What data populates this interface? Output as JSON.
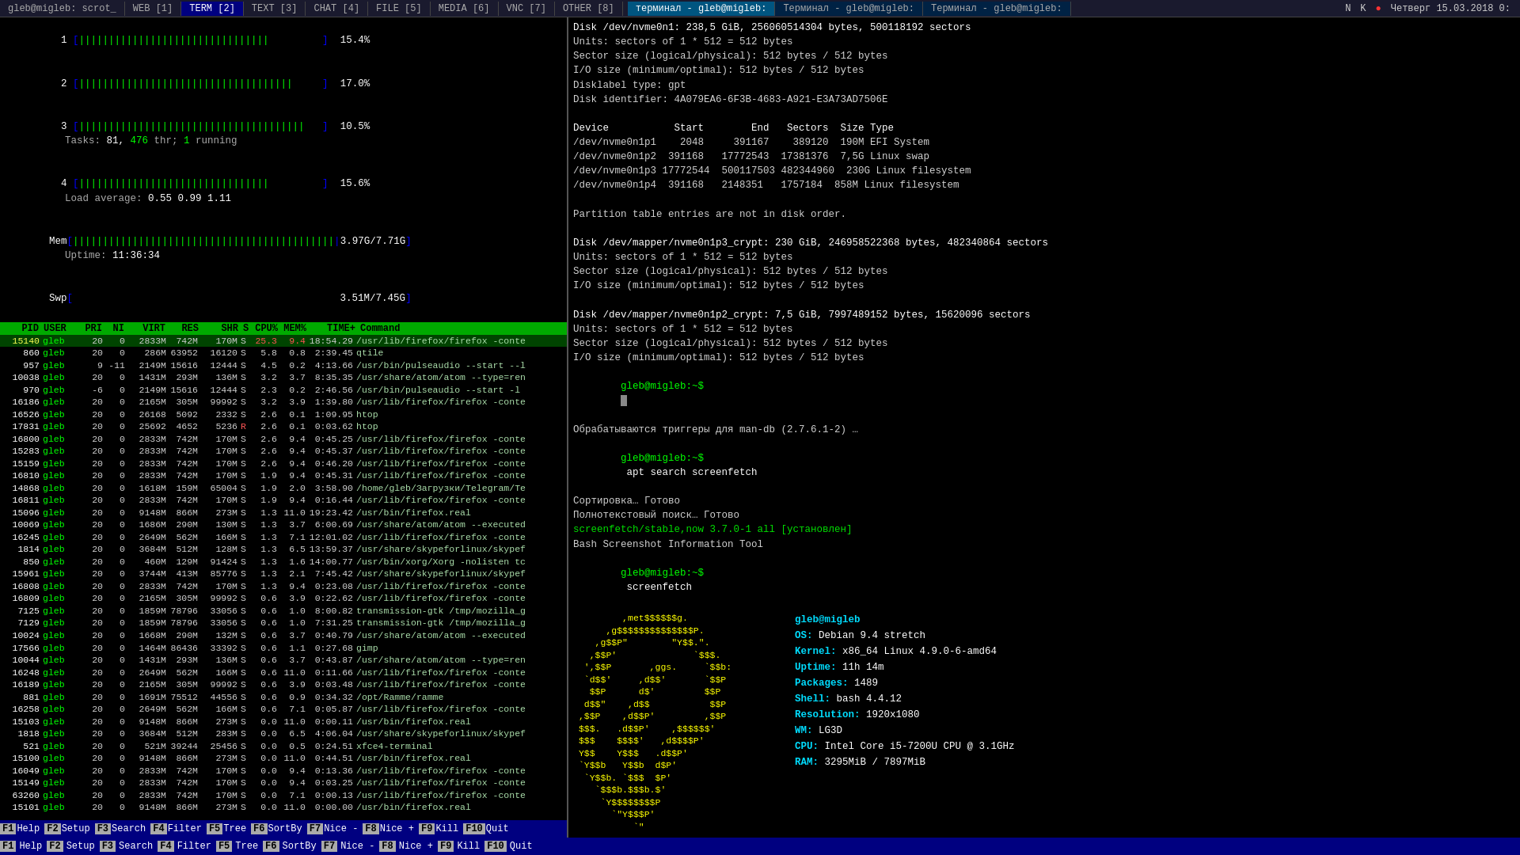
{
  "topbar": {
    "tabs": [
      {
        "label": "gleb@migleb: scrot_",
        "active": false,
        "type": "main"
      },
      {
        "label": "WEB [1]",
        "active": false
      },
      {
        "label": "TERM [2]",
        "active": true
      },
      {
        "label": "TEXT [3]",
        "active": false
      },
      {
        "label": "CHAT [4]",
        "active": false
      },
      {
        "label": "FILE [5]",
        "active": false
      },
      {
        "label": "MEDIA [6]",
        "active": false
      },
      {
        "label": "VNC [7]",
        "active": false
      },
      {
        "label": "OTHER [8]",
        "active": false
      }
    ],
    "right_tabs": [
      {
        "label": "терминал - gleb@migleb:",
        "active": true
      },
      {
        "label": "Терминал - gleb@migleb:",
        "active": false
      },
      {
        "label": "Терминал - gleb@migleb:",
        "active": false
      }
    ],
    "clock": "Четверг 15.03.2018 0:",
    "icons": [
      "N",
      "K",
      "🔴"
    ]
  },
  "htop": {
    "cpu_bars": [
      {
        "id": "1",
        "bar": "||||||||||||||||||||||||||||||||",
        "pct": "15.4"
      },
      {
        "id": "2",
        "bar": "||||||||||||||||||||||||||||||||||||",
        "pct": "17.0"
      },
      {
        "id": "3",
        "bar": "||||||||||||||||||||||||||||||||||||||",
        "pct": "10.5"
      },
      {
        "id": "4",
        "bar": "||||||||||||||||||||||||||||||||",
        "pct": "15.6"
      }
    ],
    "mem": {
      "bar": "||||||||||||||||||||||||||||||||||||||||||||",
      "used": "3.97G",
      "total": "7.71G"
    },
    "swp": {
      "bar": "",
      "used": "3.51M",
      "total": "7.45G"
    },
    "tasks": "81",
    "thr": "476",
    "running": "1",
    "load_avg": "0.55 0.99 1.11",
    "uptime": "11:36:34",
    "columns": [
      "PID",
      "USER",
      "PRI",
      "NI",
      "VIRT",
      "RES",
      "SHR",
      "S",
      "CPU%",
      "MEM%",
      "TIME+",
      "Command"
    ],
    "processes": [
      {
        "pid": "15140",
        "user": "gleb",
        "pri": "20",
        "ni": "0",
        "virt": "2833M",
        "res": "742M",
        "shr": "170M",
        "s": "S",
        "cpu": "25.3",
        "mem": "9.4",
        "time": "18:54.29",
        "cmd": "/usr/lib/firefox/firefox -conte",
        "selected": true
      },
      {
        "pid": "860",
        "user": "gleb",
        "pri": "20",
        "ni": "0",
        "virt": "286M",
        "res": "63952",
        "shr": "16120",
        "s": "S",
        "cpu": "5.8",
        "mem": "0.8",
        "time": "2:39.45",
        "cmd": "qtile"
      },
      {
        "pid": "957",
        "user": "gleb",
        "pri": "9",
        "ni": "-11",
        "virt": "2149M",
        "res": "15616",
        "shr": "12444",
        "s": "S",
        "cpu": "4.2",
        "mem": "0.2",
        "time": "4:13.66",
        "cmd": "/usr/bin/pulseaudio --start --l"
      },
      {
        "pid": "10038",
        "user": "gleb",
        "pri": "20",
        "ni": "0",
        "virt": "1431M",
        "res": "293M",
        "shr": "136M",
        "s": "S",
        "cpu": "3.2",
        "mem": "3.7",
        "time": "8:35.35",
        "cmd": "/usr/share/atom/atom --type=ren"
      },
      {
        "pid": "970",
        "user": "gleb",
        "pri": "-6",
        "ni": "0",
        "virt": "2149M",
        "res": "15616",
        "shr": "12444",
        "s": "S",
        "cpu": "2.3",
        "mem": "0.2",
        "time": "2:46.56",
        "cmd": "/usr/bin/pulseaudio --start -l"
      },
      {
        "pid": "16186",
        "user": "gleb",
        "pri": "20",
        "ni": "0",
        "virt": "2165M",
        "res": "305M",
        "shr": "99992",
        "s": "S",
        "cpu": "3.2",
        "mem": "3.9",
        "time": "1:39.80",
        "cmd": "/usr/lib/firefox/firefox -conte"
      },
      {
        "pid": "16526",
        "user": "gleb",
        "pri": "20",
        "ni": "0",
        "virt": "26168",
        "res": "5092",
        "shr": "2332",
        "s": "S",
        "cpu": "2.6",
        "mem": "0.1",
        "time": "1:09.95",
        "cmd": "htop"
      },
      {
        "pid": "17831",
        "user": "gleb",
        "pri": "20",
        "ni": "0",
        "virt": "25692",
        "res": "4652",
        "shr": "5236",
        "s": "R",
        "cpu": "2.6",
        "mem": "0.1",
        "time": "0:03.62",
        "cmd": "htop"
      },
      {
        "pid": "16800",
        "user": "gleb",
        "pri": "20",
        "ni": "0",
        "virt": "2833M",
        "res": "742M",
        "shr": "170M",
        "s": "S",
        "cpu": "2.6",
        "mem": "9.4",
        "time": "0:45.25",
        "cmd": "/usr/lib/firefox/firefox -conte"
      },
      {
        "pid": "15283",
        "user": "gleb",
        "pri": "20",
        "ni": "0",
        "virt": "2833M",
        "res": "742M",
        "shr": "170M",
        "s": "S",
        "cpu": "2.6",
        "mem": "9.4",
        "time": "0:45.37",
        "cmd": "/usr/lib/firefox/firefox -conte"
      },
      {
        "pid": "15159",
        "user": "gleb",
        "pri": "20",
        "ni": "0",
        "virt": "2833M",
        "res": "742M",
        "shr": "170M",
        "s": "S",
        "cpu": "2.6",
        "mem": "9.4",
        "time": "0:46.20",
        "cmd": "/usr/lib/firefox/firefox -conte"
      },
      {
        "pid": "16810",
        "user": "gleb",
        "pri": "20",
        "ni": "0",
        "virt": "2833M",
        "res": "742M",
        "shr": "170M",
        "s": "S",
        "cpu": "1.9",
        "mem": "9.4",
        "time": "0:45.31",
        "cmd": "/usr/lib/firefox/firefox -conte"
      },
      {
        "pid": "14868",
        "user": "gleb",
        "pri": "20",
        "ni": "0",
        "virt": "1618M",
        "res": "159M",
        "shr": "65004",
        "s": "S",
        "cpu": "1.9",
        "mem": "2.0",
        "time": "3:58.90",
        "cmd": "/home/gleb/Загрузки/Telegram/Te"
      },
      {
        "pid": "16811",
        "user": "gleb",
        "pri": "20",
        "ni": "0",
        "virt": "2833M",
        "res": "742M",
        "shr": "170M",
        "s": "S",
        "cpu": "1.9",
        "mem": "9.4",
        "time": "0:16.44",
        "cmd": "/usr/lib/firefox/firefox -conte"
      },
      {
        "pid": "15096",
        "user": "gleb",
        "pri": "20",
        "ni": "0",
        "virt": "9148M",
        "res": "866M",
        "shr": "273M",
        "s": "S",
        "cpu": "1.3",
        "mem": "11.0",
        "time": "19:23.42",
        "cmd": "/usr/bin/firefox.real"
      },
      {
        "pid": "10069",
        "user": "gleb",
        "pri": "20",
        "ni": "0",
        "virt": "1686M",
        "res": "290M",
        "shr": "130M",
        "s": "S",
        "cpu": "1.3",
        "mem": "3.7",
        "time": "6:00.69",
        "cmd": "/usr/share/atom/atom --executed"
      },
      {
        "pid": "16245",
        "user": "gleb",
        "pri": "20",
        "ni": "0",
        "virt": "2649M",
        "res": "562M",
        "shr": "166M",
        "s": "S",
        "cpu": "1.3",
        "mem": "7.1",
        "time": "12:01.02",
        "cmd": "/usr/lib/firefox/firefox -conte"
      },
      {
        "pid": "1814",
        "user": "gleb",
        "pri": "20",
        "ni": "0",
        "virt": "3684M",
        "res": "512M",
        "shr": "128M",
        "s": "S",
        "cpu": "1.3",
        "mem": "6.5",
        "time": "13:59.37",
        "cmd": "/usr/share/skypeforlinux/skypef"
      },
      {
        "pid": "850",
        "user": "gleb",
        "pri": "20",
        "ni": "0",
        "virt": "460M",
        "res": "129M",
        "shr": "91424",
        "s": "S",
        "cpu": "1.3",
        "mem": "1.6",
        "time": "14:00.77",
        "cmd": "/usr/bin/xorg/Xorg -nolisten tc"
      },
      {
        "pid": "15961",
        "user": "gleb",
        "pri": "20",
        "ni": "0",
        "virt": "3744M",
        "res": "413M",
        "shr": "85776",
        "s": "S",
        "cpu": "1.3",
        "mem": "2.1",
        "time": "7:45.42",
        "cmd": "/usr/share/skypeforlinux/skypef"
      },
      {
        "pid": "16808",
        "user": "gleb",
        "pri": "20",
        "ni": "0",
        "virt": "2833M",
        "res": "742M",
        "shr": "170M",
        "s": "S",
        "cpu": "1.3",
        "mem": "9.4",
        "time": "0:23.08",
        "cmd": "/usr/lib/firefox/firefox -conte"
      },
      {
        "pid": "16809",
        "user": "gleb",
        "pri": "20",
        "ni": "0",
        "virt": "2165M",
        "res": "305M",
        "shr": "99992",
        "s": "S",
        "cpu": "0.6",
        "mem": "3.9",
        "time": "0:22.62",
        "cmd": "/usr/lib/firefox/firefox -conte"
      },
      {
        "pid": "7125",
        "user": "gleb",
        "pri": "20",
        "ni": "0",
        "virt": "1859M",
        "res": "78796",
        "shr": "33056",
        "s": "S",
        "cpu": "0.6",
        "mem": "1.0",
        "time": "8:00.82",
        "cmd": "transmission-gtk /tmp/mozilla_g"
      },
      {
        "pid": "7129",
        "user": "gleb",
        "pri": "20",
        "ni": "0",
        "virt": "1859M",
        "res": "78796",
        "shr": "33056",
        "s": "S",
        "cpu": "0.6",
        "mem": "1.0",
        "time": "7:31.25",
        "cmd": "transmission-gtk /tmp/mozilla_g"
      },
      {
        "pid": "10024",
        "user": "gleb",
        "pri": "20",
        "ni": "0",
        "virt": "1668M",
        "res": "290M",
        "shr": "132M",
        "s": "S",
        "cpu": "0.6",
        "mem": "3.7",
        "time": "0:40.79",
        "cmd": "/usr/share/atom/atom --executed"
      },
      {
        "pid": "17566",
        "user": "gleb",
        "pri": "20",
        "ni": "0",
        "virt": "1464M",
        "res": "86436",
        "shr": "33392",
        "s": "S",
        "cpu": "0.6",
        "mem": "1.1",
        "time": "0:27.68",
        "cmd": "gimp"
      },
      {
        "pid": "10044",
        "user": "gleb",
        "pri": "20",
        "ni": "0",
        "virt": "1431M",
        "res": "293M",
        "shr": "136M",
        "s": "S",
        "cpu": "0.6",
        "mem": "3.7",
        "time": "0:43.87",
        "cmd": "/usr/share/atom/atom --type=ren"
      },
      {
        "pid": "16248",
        "user": "gleb",
        "pri": "20",
        "ni": "0",
        "virt": "2649M",
        "res": "562M",
        "shr": "166M",
        "s": "S",
        "cpu": "0.6",
        "mem": "11.0",
        "time": "0:11.66",
        "cmd": "/usr/lib/firefox/firefox -conte"
      },
      {
        "pid": "16189",
        "user": "gleb",
        "pri": "20",
        "ni": "0",
        "virt": "2165M",
        "res": "305M",
        "shr": "99992",
        "s": "S",
        "cpu": "0.6",
        "mem": "3.9",
        "time": "0:03.48",
        "cmd": "/usr/lib/firefox/firefox -conte"
      },
      {
        "pid": "881",
        "user": "gleb",
        "pri": "20",
        "ni": "0",
        "virt": "1691M",
        "res": "75512",
        "shr": "44556",
        "s": "S",
        "cpu": "0.6",
        "mem": "0.9",
        "time": "0:34.32",
        "cmd": "/opt/Ramme/ramme"
      },
      {
        "pid": "16258",
        "user": "gleb",
        "pri": "20",
        "ni": "0",
        "virt": "2649M",
        "res": "562M",
        "shr": "166M",
        "s": "S",
        "cpu": "0.6",
        "mem": "7.1",
        "time": "0:05.87",
        "cmd": "/usr/lib/firefox/firefox -conte"
      },
      {
        "pid": "15103",
        "user": "gleb",
        "pri": "20",
        "ni": "0",
        "virt": "9148M",
        "res": "866M",
        "shr": "273M",
        "s": "S",
        "cpu": "0.0",
        "mem": "11.0",
        "time": "0:00.11",
        "cmd": "/usr/bin/firefox.real"
      },
      {
        "pid": "1818",
        "user": "gleb",
        "pri": "20",
        "ni": "0",
        "virt": "3684M",
        "res": "512M",
        "shr": "283M",
        "s": "S",
        "cpu": "0.0",
        "mem": "6.5",
        "time": "4:06.04",
        "cmd": "/usr/share/skypeforlinux/skypef"
      },
      {
        "pid": "521",
        "user": "gleb",
        "pri": "20",
        "ni": "0",
        "virt": "521M",
        "res": "39244",
        "shr": "25456",
        "s": "S",
        "cpu": "0.0",
        "mem": "0.5",
        "time": "0:24.51",
        "cmd": "xfce4-terminal"
      },
      {
        "pid": "15100",
        "user": "gleb",
        "pri": "20",
        "ni": "0",
        "virt": "9148M",
        "res": "866M",
        "shr": "273M",
        "s": "S",
        "cpu": "0.0",
        "mem": "11.0",
        "time": "0:44.51",
        "cmd": "/usr/bin/firefox.real"
      },
      {
        "pid": "16049",
        "user": "gleb",
        "pri": "20",
        "ni": "0",
        "virt": "2833M",
        "res": "742M",
        "shr": "170M",
        "s": "S",
        "cpu": "0.0",
        "mem": "9.4",
        "time": "0:13.36",
        "cmd": "/usr/lib/firefox/firefox -conte"
      },
      {
        "pid": "15149",
        "user": "gleb",
        "pri": "20",
        "ni": "0",
        "virt": "2833M",
        "res": "742M",
        "shr": "170M",
        "s": "S",
        "cpu": "0.0",
        "mem": "9.4",
        "time": "0:03.25",
        "cmd": "/usr/lib/firefox/firefox -conte"
      },
      {
        "pid": "63260",
        "user": "gleb",
        "pri": "20",
        "ni": "0",
        "virt": "2833M",
        "res": "742M",
        "shr": "170M",
        "s": "S",
        "cpu": "0.0",
        "mem": "7.1",
        "time": "0:00.13",
        "cmd": "/usr/lib/firefox/firefox -conte"
      },
      {
        "pid": "15101",
        "user": "gleb",
        "pri": "20",
        "ni": "0",
        "virt": "9148M",
        "res": "866M",
        "shr": "273M",
        "s": "S",
        "cpu": "0.0",
        "mem": "11.0",
        "time": "0:00.00",
        "cmd": "/usr/bin/firefox.real"
      }
    ],
    "bottom_keys": [
      {
        "key": "F1",
        "label": "Help"
      },
      {
        "key": "F2",
        "label": "Setup"
      },
      {
        "key": "F3",
        "label": "Search"
      },
      {
        "key": "F4",
        "label": "Filter"
      },
      {
        "key": "F5",
        "label": "Tree"
      },
      {
        "key": "F6",
        "label": "SortBy"
      },
      {
        "key": "F7",
        "label": "Nice -"
      },
      {
        "key": "F8",
        "label": "Nice +"
      },
      {
        "key": "F9",
        "label": "Kill"
      },
      {
        "key": "F10",
        "label": "Quit"
      }
    ]
  },
  "terminal": {
    "disk_output": [
      "Disk /dev/nvme0n1: 238,5 GiB, 256060514304 bytes, 500118192 sectors",
      "Units: sectors of 1 * 512 = 512 bytes",
      "Sector size (logical/physical): 512 bytes / 512 bytes",
      "I/O size (minimum/optimal): 512 bytes / 512 bytes",
      "Disklabel type: gpt",
      "Disk identifier: 4A079EA6-6F3B-4683-A921-E3A73AD7506E",
      "",
      "Device           Start        End   Sectors  Size Type",
      "/dev/nvme0n1p1    2048     391167    389120  190M EFI System",
      "/dev/nvme0n1p2  391168   17772543  17381376  7,5G Linux swap",
      "/dev/nvme0n1p3 17772544  500117503 482344960  230G Linux filesystem",
      "/dev/nvme0n1p4  391168   2148351   1757184  858M Linux filesystem",
      "",
      "Partition table entries are not in disk order.",
      "",
      "Disk /dev/mapper/nvme0n1p3_crypt: 230 GiB, 246958522368 bytes, 482340864 sectors",
      "Units: sectors of 1 * 512 = 512 bytes",
      "Sector size (logical/physical): 512 bytes / 512 bytes",
      "I/O size (minimum/optimal): 512 bytes / 512 bytes",
      "",
      "Disk /dev/mapper/nvme0n1p2_crypt: 7,5 GiB, 7997489152 bytes, 15620096 sectors",
      "Units: sectors of 1 * 512 = 512 bytes",
      "Sector size (logical/physical): 512 bytes / 512 bytes",
      "I/O size (minimum/optimal): 512 bytes / 512 bytes"
    ],
    "prompt1": "gleb@migleb:~$",
    "cmd1": "",
    "apt_output": [
      "Обрабатываются триггеры для man-db (2.7.6.1-2) …",
      "gleb@migleb:~$ apt search screenfetch",
      "Сортировка… Готово",
      "Полнотекстовый поиск… Готово",
      "screenfetch/stable,now 3.7.0-1 all [установлен]",
      "Bash Screenshot Information Tool"
    ],
    "prompt2": "gleb@migleb:~$",
    "cmd2": "screenfetch",
    "screenfetch": {
      "logo": [
        "         ,met$$$$$gg.",
        "      ,g$$$$$$$$$$$$$$$P.",
        "    ,g$$P\"\"       \"\"\"Y$$.",
        ".\".",
        "   ,$$P'              `$$$.\"",
        "  ',$$P       ,ggs.     `$$b:",
        "  `d$$'     ,d$$'       `$$P",
        "   $$P      d$'          $$P",
        "  d$$\"    ,d$$           $$P",
        " ,$$P    ,d$$P'         ,$$P",
        " $$$.   ,d$$P'    ,$$$$$$'",
        " $$$    $$$$'   ,d$$$$P'",
        " Y$$    Y$$$   .d$$P'",
        " `Y$$b   Y$$b  d$P'",
        "  `Y$$b. `$$$  $P'",
        "    `$$$b.$$$b.$'",
        "     `Y$$$$$$$$P",
        "       `\"Y$$$P'",
        "           `\""
      ],
      "info": {
        "hostname": "gleb@migleb",
        "os_label": "OS:",
        "os": "Debian 9.4 stretch",
        "kernel_label": "Kernel:",
        "kernel": "x86_64 Linux 4.9.0-6-amd64",
        "uptime_label": "Uptime:",
        "uptime": "11h 14m",
        "packages_label": "Packages:",
        "packages": "1489",
        "shell_label": "Shell:",
        "shell": "bash 4.4.12",
        "resolution_label": "Resolution:",
        "resolution": "1920x1080",
        "wm_label": "WM:",
        "wm": "LG3D",
        "cpu_label": "CPU:",
        "cpu": "Intel Core i5-7200U CPU @ 3.1GHz",
        "ram_label": "RAM:",
        "ram": "3295MiB / 7897MiB"
      }
    },
    "prompt3": "gleb@migleb:~$",
    "cmd3": "",
    "cursor": "█"
  },
  "bottom_bar": {
    "label": "Search"
  }
}
